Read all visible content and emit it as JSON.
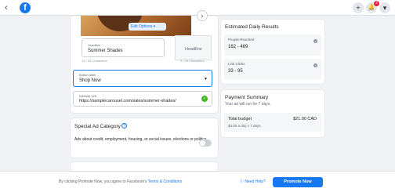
{
  "topbar": {
    "back_glyph": "‹",
    "logo_letter": "f",
    "plus_glyph": "+",
    "bell_glyph": "🔔",
    "notification_count": "2",
    "menu_glyph": "▾"
  },
  "ad_preview": {
    "edit_options_label": "Edit Options ▾",
    "next_glyph": "›",
    "headline_label": "Headline",
    "headline_value": "Summer Shades",
    "headline_chars": "13 / 25 Characters",
    "headline2_label": "Headline",
    "headline2_chars": "0 / 25 Characters",
    "headline_left_chars": "13 / 25 Characters"
  },
  "button_label_field": {
    "label": "Button label",
    "value": "Shop Now"
  },
  "website_field": {
    "label": "Website URL",
    "value": "https://samplecarousel.com/sales/summer-shades/"
  },
  "special_ad": {
    "title": "Special Ad Category",
    "description": "Ads about credit, employment, housing, or social issues, elections or politics"
  },
  "estimated": {
    "title": "Estimated Daily Results",
    "people_label": "People Reached",
    "people_value": "162 - 469",
    "clicks_label": "Link Clicks",
    "clicks_value": "33 - 95"
  },
  "payment": {
    "title": "Payment Summary",
    "subtitle": "Your ad will run for 7 days.",
    "total_label": "Total budget",
    "total_value": "$21.00 CAD",
    "total_detail": "$3.00 a day x 7 days."
  },
  "footer": {
    "terms_prefix": "By clicking Promote Now, you agree to Facebook's",
    "terms_link": "Terms & Conditions",
    "need_help": "Need Help?",
    "promote_label": "Promote Now"
  }
}
